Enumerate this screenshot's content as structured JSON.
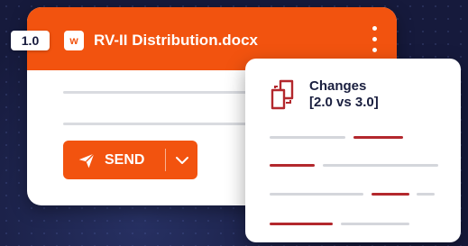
{
  "document": {
    "version_badge": "1.0",
    "file_icon_letter": "w",
    "title": "RV-II Distribution.docx",
    "send_label": "SEND"
  },
  "changes": {
    "title": "Changes",
    "subtitle": "[2.0 vs 3.0]"
  },
  "colors": {
    "accent": "#f2530f",
    "diff_changed": "#b3282d",
    "diff_unchanged": "#d4d6db",
    "background": "#161a3c"
  },
  "icons": {
    "file": "word-file-icon",
    "menu": "more-vertical-icon",
    "send": "paper-plane-icon",
    "dropdown": "chevron-down-icon",
    "compare": "compare-documents-icon"
  }
}
